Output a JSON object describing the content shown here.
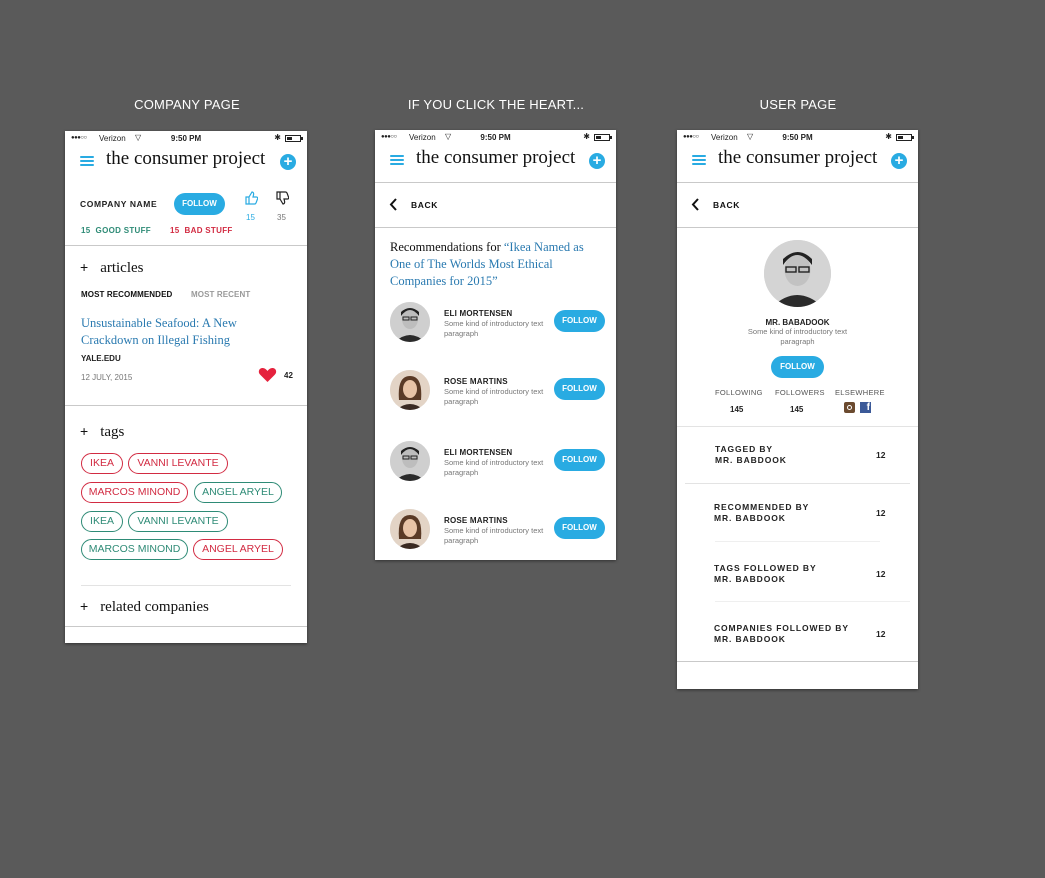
{
  "panels": {
    "company": "COMPANY PAGE",
    "heart": "IF YOU CLICK THE HEART...",
    "user": "USER PAGE"
  },
  "status_bar": {
    "carrier": "Verizon",
    "time": "9:50 PM"
  },
  "app": {
    "brand": "the consumer project"
  },
  "company_page": {
    "company_name": "COMPANY NAME",
    "follow_label": "FOLLOW",
    "thumbs_up_count": "15",
    "thumbs_down_count": "35",
    "good_stuff": {
      "count": "15",
      "label": "GOOD STUFF"
    },
    "bad_stuff": {
      "count": "15",
      "label": "BAD STUFF"
    },
    "articles": {
      "title": "articles",
      "tabs": [
        "MOST RECOMMENDED",
        "MOST RECENT"
      ],
      "article_title": "Unsustainable Seafood: A New Crackdown on Illegal Fishing",
      "source": "YALE.EDU",
      "date": "12 JULY, 2015",
      "likes": "42"
    },
    "tags": {
      "title": "tags",
      "items": [
        {
          "label": "IKEA",
          "color": "red"
        },
        {
          "label": "VANNI LEVANTE",
          "color": "red"
        },
        {
          "label": "MARCOS MINOND",
          "color": "red"
        },
        {
          "label": "ANGEL ARYEL",
          "color": "green"
        },
        {
          "label": "IKEA",
          "color": "green"
        },
        {
          "label": "VANNI LEVANTE",
          "color": "green"
        },
        {
          "label": "MARCOS MINOND",
          "color": "green"
        },
        {
          "label": "ANGEL ARYEL",
          "color": "red"
        }
      ]
    },
    "related_title": "related companies"
  },
  "heart_page": {
    "back_label": "BACK",
    "rec_prefix": "Recommendations for ",
    "rec_quote": "“Ikea Named as One of The Worlds Most Ethical Companies for 2015”",
    "people": [
      {
        "name": "ELI MORTENSEN",
        "desc": "Some kind of introductory text paragraph",
        "follow": "FOLLOW"
      },
      {
        "name": "ROSE MARTINS",
        "desc": "Some kind of introductory text paragraph",
        "follow": "FOLLOW"
      },
      {
        "name": "ELI MORTENSEN",
        "desc": "Some kind of introductory text paragraph",
        "follow": "FOLLOW"
      },
      {
        "name": "ROSE MARTINS",
        "desc": "Some kind of introductory text paragraph",
        "follow": "FOLLOW"
      }
    ]
  },
  "user_page": {
    "back_label": "BACK",
    "name": "MR. BABADOOK",
    "desc": "Some kind of introductory text paragraph",
    "follow_label": "FOLLOW",
    "stats": [
      {
        "label": "FOLLOWING",
        "value": "145"
      },
      {
        "label": "FOLLOWERS",
        "value": "145"
      },
      {
        "label": "ELSEWHERE",
        "value": ""
      }
    ],
    "rows": [
      {
        "line1": "TAGGED BY",
        "line2": "MR. BABDOOK",
        "value": "12"
      },
      {
        "line1": "RECOMMENDED BY",
        "line2": "MR. BABDOOK",
        "value": "12"
      },
      {
        "line1": "TAGS FOLLOWED BY",
        "line2": "MR. BABDOOK",
        "value": "12"
      },
      {
        "line1": "COMPANIES FOLLOWED BY",
        "line2": "MR. BABDOOK",
        "value": "12"
      }
    ]
  },
  "colors": {
    "accent": "#29abe2",
    "good": "#2e8b76",
    "bad": "#d22b42",
    "background": "#5a5a5a"
  }
}
